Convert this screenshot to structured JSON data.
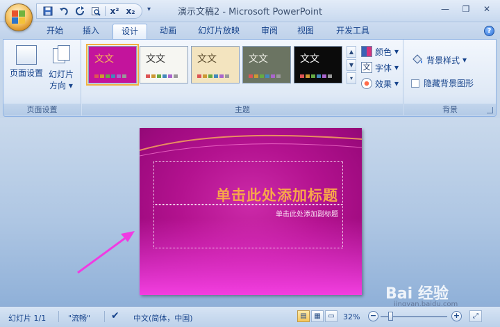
{
  "window": {
    "title": "演示文稿2 - Microsoft PowerPoint"
  },
  "quick_access": {
    "items": [
      "save-icon",
      "undo-icon",
      "redo-icon",
      "print-preview-icon",
      "superscript-icon",
      "subscript-icon"
    ],
    "superscript_label": "x²",
    "subscript_label": "x₂"
  },
  "tabs": [
    "开始",
    "插入",
    "设计",
    "动画",
    "幻灯片放映",
    "审阅",
    "视图",
    "开发工具"
  ],
  "active_tab": "设计",
  "ribbon": {
    "page_setup": {
      "page_setup_label": "页面设置",
      "orientation_label_1": "幻灯片",
      "orientation_label_2": "方向",
      "group_label": "页面设置"
    },
    "themes": {
      "group_label": "主题",
      "thumb_text": "文文",
      "items": [
        {
          "bg": "#c3149c",
          "text_color": "#f7b35a",
          "selected": true
        },
        {
          "bg": "#f6f6f2",
          "text_color": "#333333",
          "selected": false
        },
        {
          "bg": "#f3e4bf",
          "text_color": "#5a4a2c",
          "selected": false
        },
        {
          "bg": "#6b7462",
          "text_color": "#f1f1e8",
          "selected": false
        },
        {
          "bg": "#0b0b0b",
          "text_color": "#ffffff",
          "selected": false
        }
      ],
      "colors_label": "颜色",
      "fonts_label": "字体",
      "effects_label": "效果"
    },
    "background": {
      "group_label": "背景",
      "bg_style_label": "背景样式",
      "hide_bg_label": "隐藏背景图形"
    }
  },
  "slide": {
    "title_placeholder": "单击此处添加标题",
    "subtitle_placeholder": "单击此处添加副标题"
  },
  "statusbar": {
    "slide_count": "幻灯片 1/1",
    "theme_name": "\"流畅\"",
    "language": "中文(简体，中国)",
    "zoom": "32%"
  },
  "watermark": {
    "brand": "Bai 经验",
    "url": "jingyan.baidu.com"
  }
}
